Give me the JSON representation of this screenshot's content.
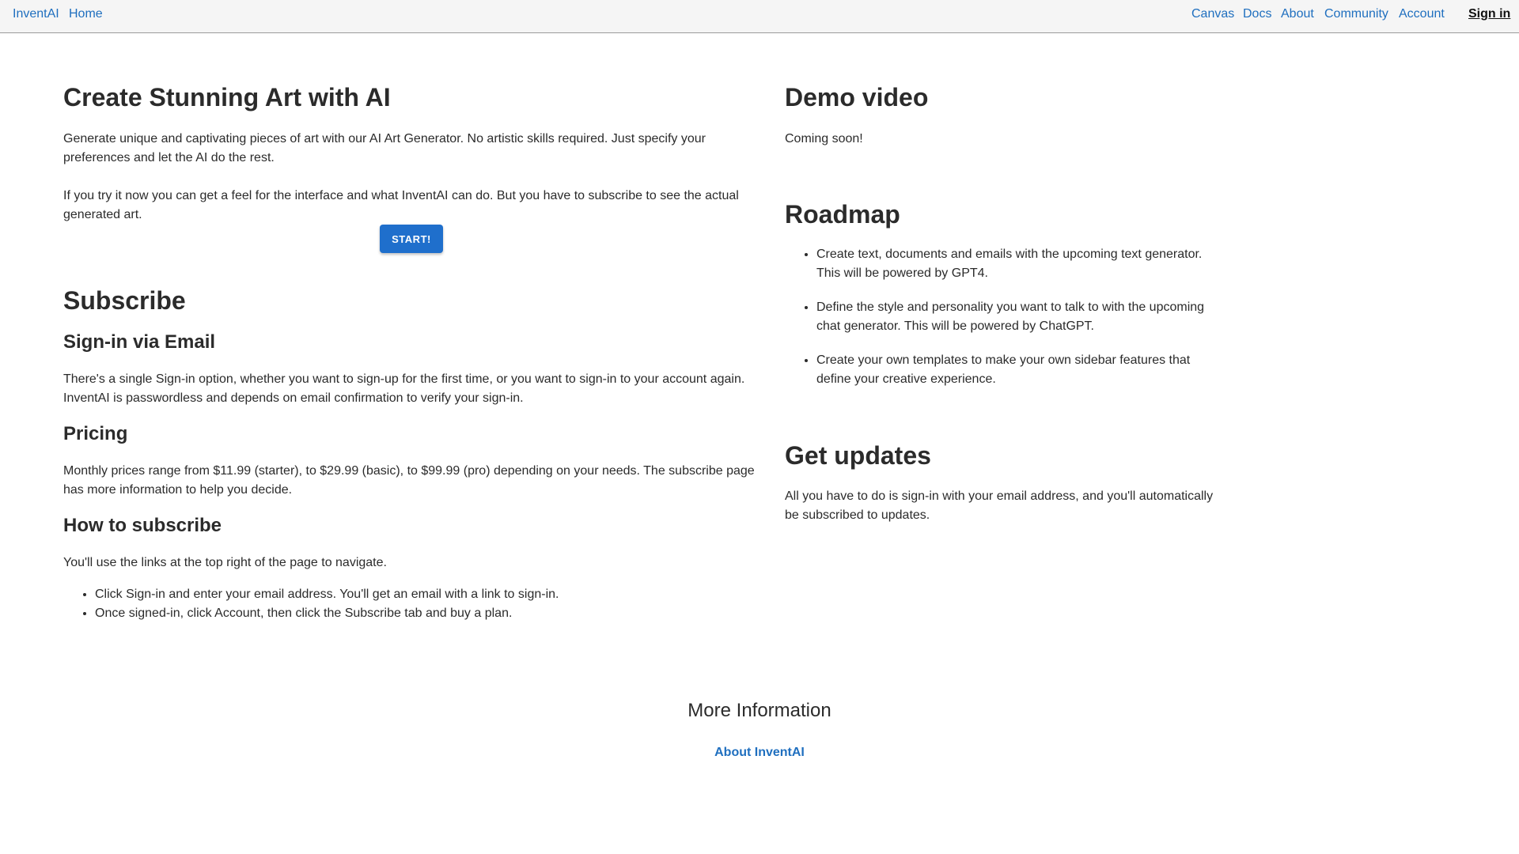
{
  "nav": {
    "brand": "InventAI",
    "home": "Home",
    "canvas": "Canvas",
    "docs": "Docs",
    "about": "About",
    "community": "Community",
    "account": "Account",
    "signin": "Sign in"
  },
  "hero": {
    "title": "Create Stunning Art with AI",
    "p1": "Generate unique and captivating pieces of art with our AI Art Generator. No artistic skills required. Just specify your preferences and let the AI do the rest.",
    "p2": "If you try it now you can get a feel for the interface and what InventAI can do. But you have to subscribe to see the actual generated art.",
    "start_label": "START!"
  },
  "subscribe": {
    "title": "Subscribe",
    "signin_title": "Sign-in via Email",
    "signin_text": "There's a single Sign-in option, whether you want to sign-up for the first time, or you want to sign-in to your account again. InventAI is passwordless and depends on email confirmation to verify your sign-in.",
    "pricing_title": "Pricing",
    "pricing_text": "Monthly prices range from $11.99 (starter), to $29.99 (basic), to $99.99 (pro) depending on your needs. The subscribe page has more information to help you decide.",
    "how_title": "How to subscribe",
    "how_text": "You'll use the links at the top right of the page to navigate.",
    "steps": [
      "Click Sign-in and enter your email address. You'll get an email with a link to sign-in.",
      "Once signed-in, click Account, then click the Subscribe tab and buy a plan."
    ]
  },
  "demo": {
    "title": "Demo video",
    "text": "Coming soon!"
  },
  "roadmap": {
    "title": "Roadmap",
    "items": [
      "Create text, documents and emails with the upcoming text generator. This will be powered by GPT4.",
      "Define the style and personality you want to talk to with the upcoming chat generator. This will be powered by ChatGPT.",
      "Create your own templates to make your own sidebar features that define your creative experience."
    ]
  },
  "updates": {
    "title": "Get updates",
    "text": "All you have to do is sign-in with your email address, and you'll automatically be subscribed to updates."
  },
  "footer": {
    "title": "More Information",
    "link": "About InventAI"
  },
  "colors": {
    "link": "#1f6fbf",
    "button": "#1f6fcc",
    "text": "#2b2b2b",
    "topbar": "#f5f5f5"
  }
}
